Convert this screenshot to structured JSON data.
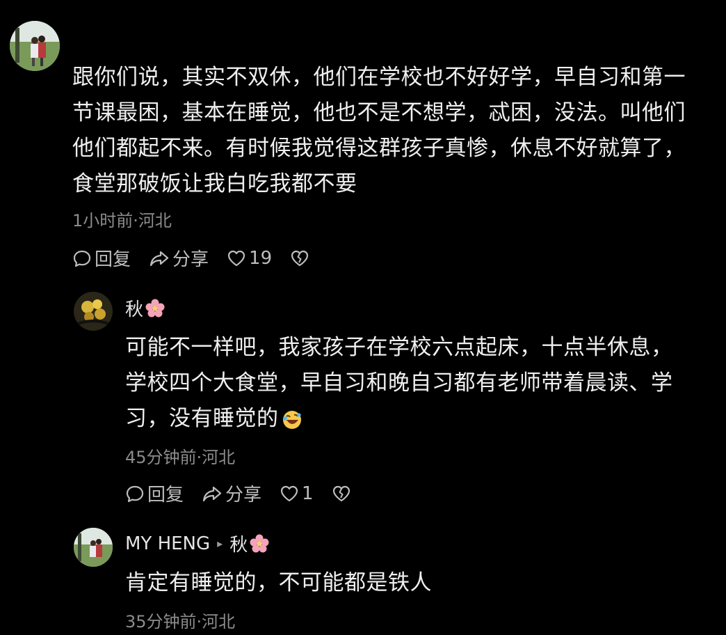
{
  "comment_top": {
    "text_lines": [
      "跟你们说，其实不双休，他们在学校也不好好学，早自习和第一",
      "节课最困，基本在睡觉，他也不是不想学，忒困，没法。叫他们",
      "他们都起不来。有时候我觉得这群孩子真惨，休息不好就算了，",
      "食堂那破饭让我白吃我都不要"
    ],
    "meta": "1小时前·河北",
    "reply_label": "回复",
    "share_label": "分享",
    "like_count": "19"
  },
  "reply_1": {
    "username": "秋",
    "text_lines": [
      "可能不一样吧，我家孩子在学校六点起床，十点半休息，",
      "学校四个大食堂，早自习和晚自习都有老师带着晨读、学",
      "习，没有睡觉的"
    ],
    "meta": "45分钟前·河北",
    "reply_label": "回复",
    "share_label": "分享",
    "like_count": "1"
  },
  "reply_2": {
    "username": "MY HENG",
    "reply_to": "秋",
    "text_lines": [
      "肯定有睡觉的，不可能都是铁人"
    ],
    "meta": "35分钟前·河北"
  },
  "icons": {
    "reply": "speech-bubble-icon",
    "share": "share-arrow-icon",
    "like": "heart-icon",
    "dislike": "broken-heart-icon",
    "flower": "cherry-blossom-emoji",
    "laugh": "rolling-laugh-emoji"
  },
  "colors": {
    "background": "#000000",
    "text": "#efefef",
    "meta": "#8c8c8c",
    "action": "#bdbdbd"
  }
}
